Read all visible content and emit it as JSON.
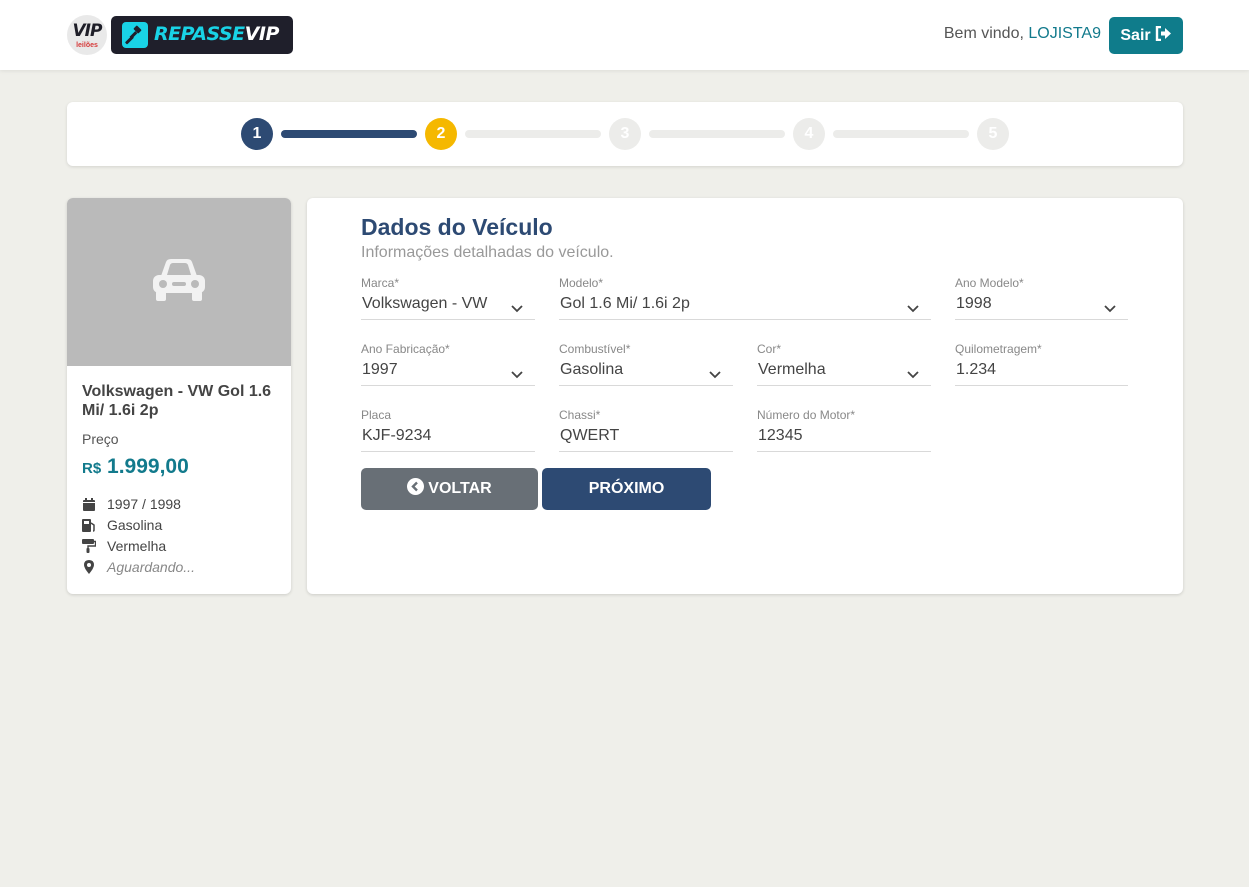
{
  "header": {
    "logo_vip_text": "VIP",
    "logo_vip_sub": "leilões",
    "logo_brand_a": "REPASSE",
    "logo_brand_b": "VIP",
    "welcome_prefix": "Bem vindo,",
    "username": "LOJISTA9",
    "logout_label": "Sair"
  },
  "stepper": {
    "steps": [
      "1",
      "2",
      "3",
      "4",
      "5"
    ],
    "current": 2
  },
  "vehicle_card": {
    "title": "Volkswagen - VW Gol 1.6 Mi/ 1.6i 2p",
    "price_label": "Preço",
    "currency": "R$",
    "price": "1.999,00",
    "year": "1997 / 1998",
    "fuel": "Gasolina",
    "color": "Vermelha",
    "location": "Aguardando..."
  },
  "form": {
    "title": "Dados do Veículo",
    "subtitle": "Informações detalhadas do veículo.",
    "fields": {
      "marca": {
        "label": "Marca*",
        "value": "Volkswagen - VW"
      },
      "modelo": {
        "label": "Modelo*",
        "value": "Gol 1.6 Mi/ 1.6i 2p"
      },
      "ano_modelo": {
        "label": "Ano Modelo*",
        "value": "1998"
      },
      "ano_fabricacao": {
        "label": "Ano Fabricação*",
        "value": "1997"
      },
      "combustivel": {
        "label": "Combustível*",
        "value": "Gasolina"
      },
      "cor": {
        "label": "Cor*",
        "value": "Vermelha"
      },
      "quilometragem": {
        "label": "Quilometragem*",
        "value": "1.234"
      },
      "placa": {
        "label": "Placa",
        "value": "KJF-9234"
      },
      "chassi": {
        "label": "Chassi*",
        "value": "QWERT"
      },
      "numero_motor": {
        "label": "Número do Motor*",
        "value": "12345"
      }
    },
    "back_label": "VOLTAR",
    "next_label": "PRÓXIMO"
  },
  "colors": {
    "primary": "#2d4a73",
    "accent": "#0f7c8b",
    "active_step": "#f5b800",
    "back_button": "#686f76"
  }
}
